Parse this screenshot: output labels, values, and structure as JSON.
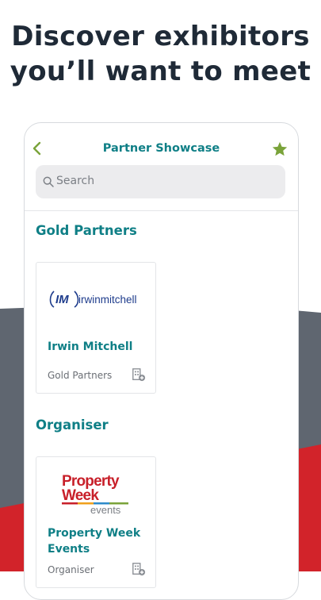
{
  "headline": {
    "line1": "Discover exhibitors",
    "line2": "you’ll want to meet"
  },
  "app": {
    "title": "Partner Showcase",
    "back_icon": "chevron-left-icon",
    "favorite_icon": "star-icon",
    "search": {
      "placeholder": "Search",
      "icon": "search-icon"
    }
  },
  "sections": [
    {
      "title": "Gold Partners",
      "cards": [
        {
          "logo_text": "irwinmitchell",
          "logo_mark": "IM",
          "name": "Irwin Mitchell",
          "category": "Gold Partners",
          "icon": "add-building-icon"
        }
      ]
    },
    {
      "title": "Organiser",
      "cards": [
        {
          "logo_line1": "Property",
          "logo_line2": "Week",
          "logo_line3": "events",
          "name": "Property Week Events",
          "category": "Organiser",
          "icon": "add-building-icon"
        }
      ]
    }
  ],
  "colors": {
    "accent": "#0f7f86",
    "star": "#7aa33a",
    "gray_band": "#5f6670",
    "red_band": "#d2232a",
    "headline": "#1f2a37"
  }
}
